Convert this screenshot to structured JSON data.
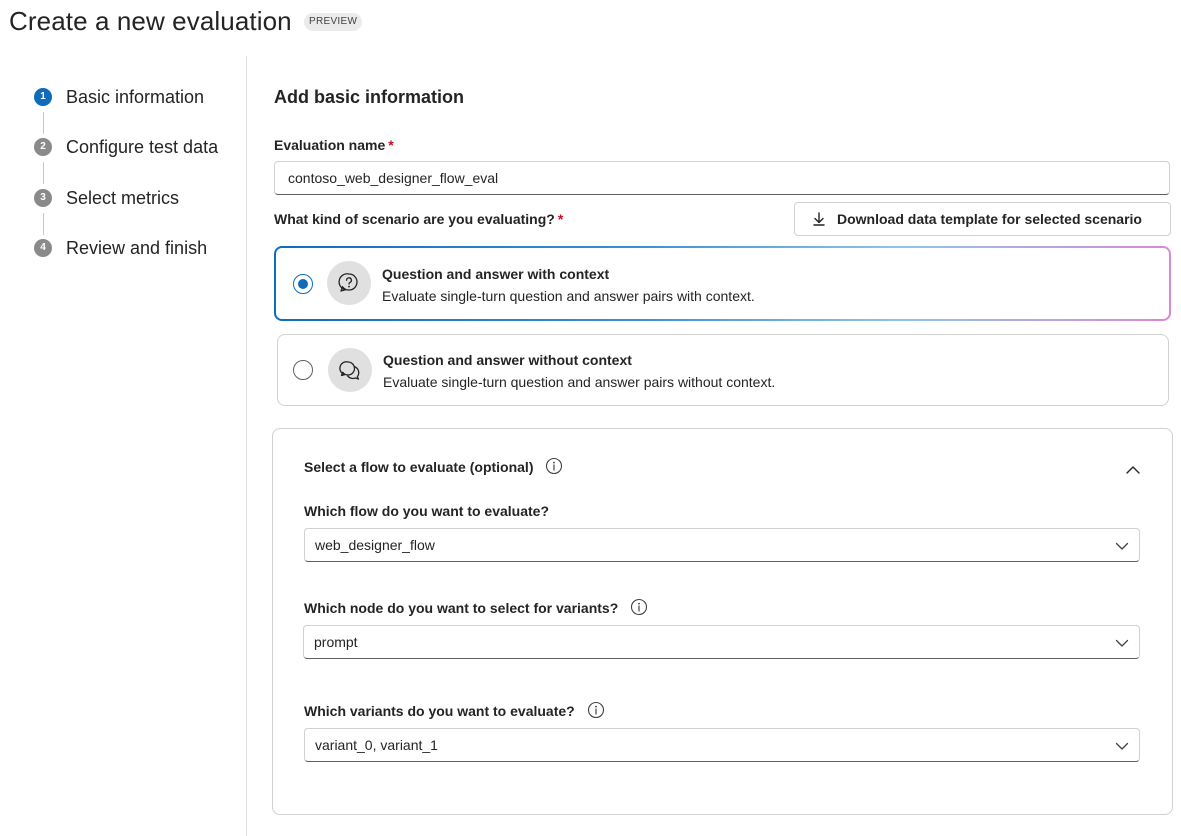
{
  "header": {
    "title": "Create a new evaluation",
    "badge": "PREVIEW"
  },
  "steps": [
    {
      "number": "1",
      "label": "Basic information",
      "active": true
    },
    {
      "number": "2",
      "label": "Configure test data",
      "active": false
    },
    {
      "number": "3",
      "label": "Select metrics",
      "active": false
    },
    {
      "number": "4",
      "label": "Review and finish",
      "active": false
    }
  ],
  "form": {
    "section_title": "Add basic information",
    "name_label": "Evaluation name",
    "required_mark": "*",
    "name_value": "contoso_web_designer_flow_eval",
    "scenario_label": "What kind of scenario are you evaluating?",
    "download_button": "Download data template for selected scenario"
  },
  "scenarios": [
    {
      "title": "Question and answer with context",
      "description": "Evaluate single-turn question and answer pairs with context.",
      "selected": true,
      "icon": "chat-question-icon"
    },
    {
      "title": "Question and answer without context",
      "description": "Evaluate single-turn question and answer pairs without context.",
      "selected": false,
      "icon": "chat-multiple-icon"
    }
  ],
  "flow_panel": {
    "title": "Select a flow to evaluate (optional)",
    "flow_label": "Which flow do you want to evaluate?",
    "flow_value": "web_designer_flow",
    "node_label": "Which node do you want to select for variants?",
    "node_value": "prompt",
    "variants_label": "Which variants do you want to evaluate?",
    "variants_value": "variant_0, variant_1"
  },
  "colors": {
    "accent": "#0f6cbd",
    "required": "#c50f1f",
    "gradient_end": "#d889d6"
  }
}
